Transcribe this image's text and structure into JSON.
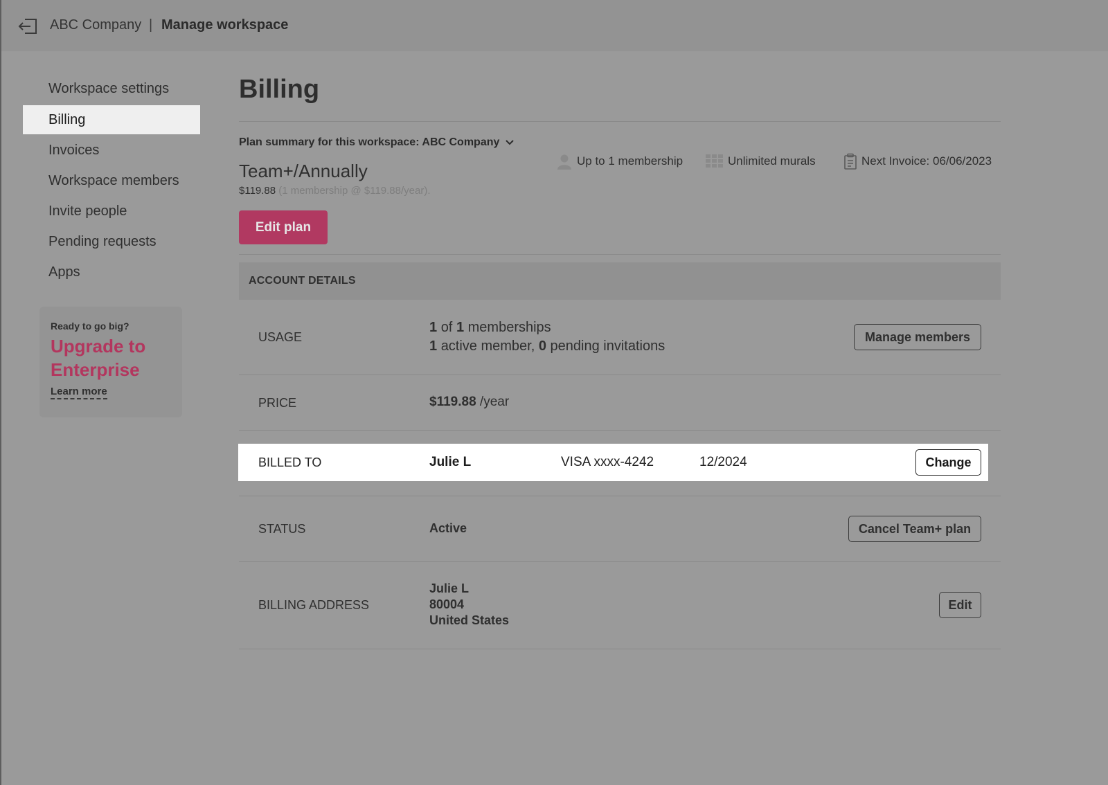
{
  "header": {
    "company": "ABC Company",
    "separator": "|",
    "title": "Manage workspace",
    "exit_icon": "exit-icon"
  },
  "sidebar": {
    "items": [
      {
        "label": "Workspace settings"
      },
      {
        "label": "Billing",
        "active": true
      },
      {
        "label": "Invoices"
      },
      {
        "label": "Workspace members"
      },
      {
        "label": "Invite people"
      },
      {
        "label": "Pending requests"
      },
      {
        "label": "Apps"
      }
    ],
    "promo": {
      "kicker": "Ready to go big?",
      "title": "Upgrade to Enterprise",
      "link": "Learn more"
    }
  },
  "main": {
    "title": "Billing",
    "plan_summary": "Plan summary for this workspace: ABC Company",
    "features": [
      {
        "icon": "user-icon",
        "label": "Up to 1 membership"
      },
      {
        "icon": "grid-icon",
        "label": "Unlimited murals"
      },
      {
        "icon": "clipboard-icon",
        "label": "Next Invoice: 06/06/2023"
      }
    ],
    "plan_name": "Team+/Annually",
    "plan_price": "$119.88",
    "plan_price_detail": "(1 membership @ $119.88/year).",
    "edit_plan_label": "Edit plan",
    "account_details": {
      "header": "ACCOUNT DETAILS",
      "usage": {
        "label": "USAGE",
        "memberships_used": "1",
        "of_text": "of",
        "memberships_total": "1",
        "memberships_text": "memberships",
        "active_count": "1",
        "active_text": "active member,",
        "pending_count": "0",
        "pending_text": "pending invitations",
        "button": "Manage members"
      },
      "price": {
        "label": "PRICE",
        "amount": "$119.88",
        "period": "/year"
      },
      "billed_to": {
        "label": "BILLED TO",
        "name": "Julie L",
        "card": "VISA xxxx-4242",
        "expiry": "12/2024",
        "button": "Change"
      },
      "status": {
        "label": "STATUS",
        "value": "Active",
        "button": "Cancel Team+ plan"
      },
      "billing_address": {
        "label": "BILLING ADDRESS",
        "name": "Julie L",
        "postal": "80004",
        "country": "United States",
        "button": "Edit"
      }
    }
  },
  "colors": {
    "accent": "#b13961",
    "overlay": "#9a9a9a",
    "highlight": "#ffffff"
  }
}
